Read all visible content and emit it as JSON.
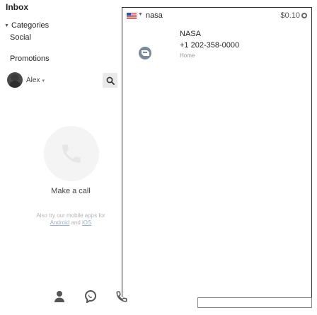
{
  "sidebar": {
    "inbox_label": "Inbox",
    "categories_label": "Categories",
    "items": [
      {
        "label": "Social"
      },
      {
        "label": "Promotions"
      }
    ]
  },
  "account": {
    "name": "Alex",
    "chevron": "▾"
  },
  "call_panel": {
    "make_call": "Make a call",
    "also_text": "Also try our mobile apps for",
    "android_link": "Android",
    "and_text": "and",
    "ios_link": "iOS"
  },
  "bottom_nav": [
    {
      "icon": "person-icon"
    },
    {
      "icon": "chat-icon"
    },
    {
      "icon": "phone-icon"
    }
  ],
  "dial_bar": {
    "number_input": "nasa",
    "price": "$0.10",
    "flag_icon": "us-flag-icon"
  },
  "contact": {
    "name": "NASA",
    "number": "+1 202-358-0000",
    "type": "Home"
  },
  "colors": {
    "panel_border": "#333333",
    "muted_text": "#b5b5b5",
    "link_text": "#9fb0c8"
  }
}
